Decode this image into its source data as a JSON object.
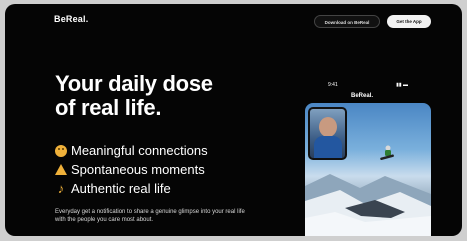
{
  "header": {
    "brand": "BeReal.",
    "secondary_button": "Download on BeReal",
    "primary_button": "Get the App"
  },
  "hero": {
    "headline_line1": "Your daily dose",
    "headline_line2": "of real life.",
    "features": [
      {
        "icon": "smile-icon",
        "label": "Meaningful connections"
      },
      {
        "icon": "warning-icon",
        "label": "Spontaneous moments"
      },
      {
        "icon": "music-icon",
        "label": "Authentic real life"
      }
    ],
    "description": "Everyday get a notification to share a genuine glimpse into your real life with the people you care most about."
  },
  "phone": {
    "title": "BeReal.",
    "time": "9:41",
    "status": "▮▮ ▬"
  },
  "colors": {
    "background": "#050505",
    "accent_yellow": "#f0b13a",
    "text": "#ffffff"
  }
}
